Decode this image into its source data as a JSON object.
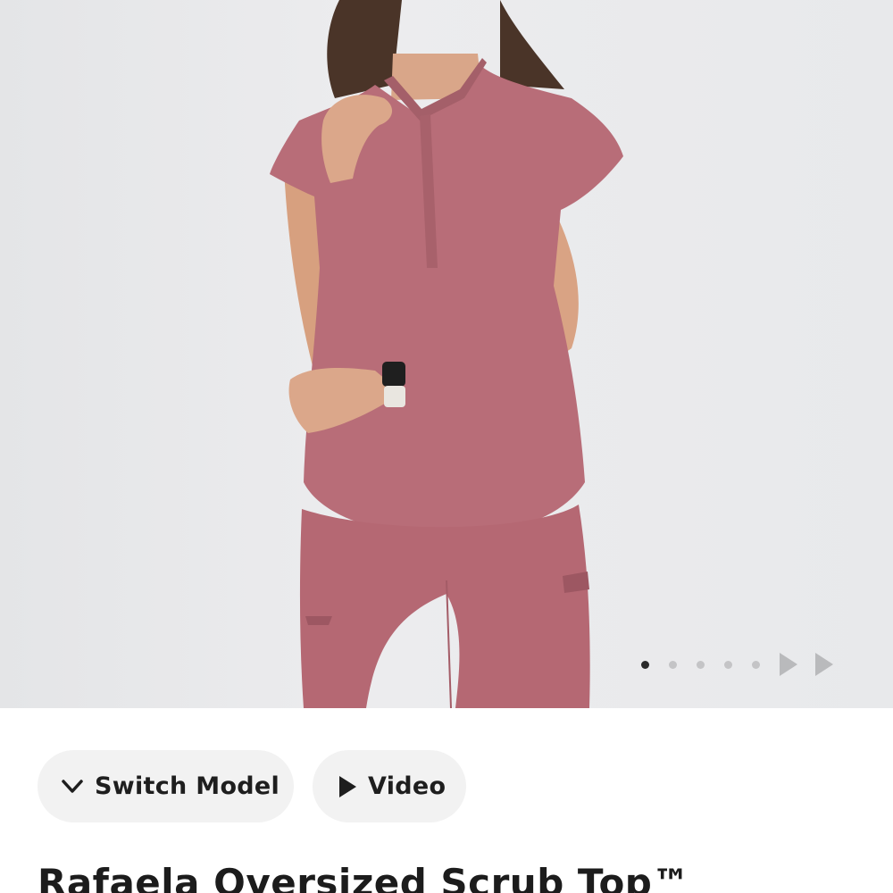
{
  "gallery": {
    "image_alt_icon": "product-photo",
    "dots_total": 5,
    "dots_active_index": 0,
    "arrow_icons": [
      "play-arrow-icon",
      "play-arrow-icon"
    ],
    "colors": {
      "background": "#e8e9eb",
      "garment": "#b86d78",
      "dot_active": "#2b2b2b",
      "dot_inactive": "#c4c4c6",
      "arrow": "#b9babc"
    }
  },
  "actions": {
    "switch_model_label": "Switch Model",
    "switch_model_icon": "chevron-down-icon",
    "video_label": "Video",
    "video_icon": "play-icon",
    "pill_background": "#f2f2f2"
  },
  "product": {
    "title": "Rafaela Oversized Scrub Top™"
  }
}
